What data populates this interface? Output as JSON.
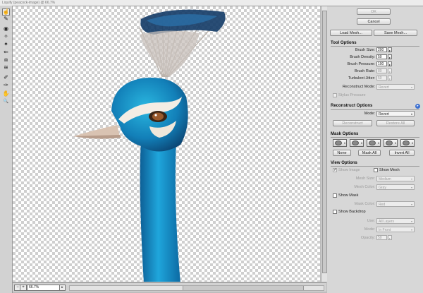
{
  "window": {
    "title": "Liquify (peacock-image) @ 66.7%"
  },
  "tools": [
    {
      "name": "forward-warp-tool",
      "glyph": "☝",
      "active": true
    },
    {
      "name": "reconstruct-tool",
      "glyph": "✎"
    },
    {
      "name": "twirl-tool",
      "glyph": "◉"
    },
    {
      "name": "pucker-tool",
      "glyph": "✧"
    },
    {
      "name": "bloat-tool",
      "glyph": "✦"
    },
    {
      "name": "push-left-tool",
      "glyph": "⇐"
    },
    {
      "name": "mirror-tool",
      "glyph": "⧈"
    },
    {
      "name": "turbulence-tool",
      "glyph": "≋"
    },
    {
      "name": "freeze-mask-tool",
      "glyph": "✐"
    },
    {
      "name": "thaw-mask-tool",
      "glyph": "✑"
    },
    {
      "name": "hand-tool",
      "glyph": "✋"
    },
    {
      "name": "zoom-tool",
      "glyph": "🔍"
    }
  ],
  "status": {
    "zoom": "66.7%",
    "minus": "−",
    "plus": "+",
    "arrow": "▸"
  },
  "buttons": {
    "ok": "OK",
    "cancel": "Cancel",
    "load_mesh": "Load Mesh...",
    "save_mesh": "Save Mesh...",
    "reconstruct": "Reconstruct",
    "restore_all": "Restore All",
    "none": "None",
    "mask_all": "Mask All",
    "invert_all": "Invert All"
  },
  "tool_options": {
    "title": "Tool Options",
    "brush_size": {
      "label": "Brush Size:",
      "value": "200"
    },
    "brush_density": {
      "label": "Brush Density:",
      "value": "50"
    },
    "brush_pressure": {
      "label": "Brush Pressure:",
      "value": "100"
    },
    "brush_rate": {
      "label": "Brush Rate:",
      "value": "80"
    },
    "turbulent_jitter": {
      "label": "Turbulent Jitter:",
      "value": "50"
    },
    "reconstruct_mode": {
      "label": "Reconstruct Mode:",
      "value": "Revert"
    },
    "stylus_pressure": "Stylus Pressure"
  },
  "reconstruct_options": {
    "title": "Reconstruct Options",
    "mode_label": "Mode:",
    "mode_value": "Revert"
  },
  "mask_options": {
    "title": "Mask Options"
  },
  "view_options": {
    "title": "View Options",
    "show_image": "Show Image",
    "show_mesh": "Show Mesh",
    "mesh_size": {
      "label": "Mesh Size:",
      "value": "Medium"
    },
    "mesh_color": {
      "label": "Mesh Color:",
      "value": "Gray"
    },
    "show_mask": "Show Mask",
    "mask_color": {
      "label": "Mask Color:",
      "value": "Red"
    },
    "show_backdrop": "Show Backdrop",
    "use": {
      "label": "Use:",
      "value": "All Layers"
    },
    "mode": {
      "label": "Mode:",
      "value": "In Front"
    },
    "opacity": {
      "label": "Opacity:",
      "value": "50"
    }
  },
  "colors": {
    "peacock_blue": "#1a9fd6",
    "panel": "#d7d7d7"
  }
}
